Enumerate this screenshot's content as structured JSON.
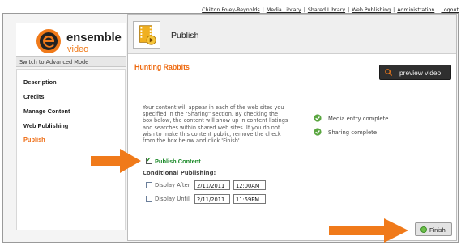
{
  "top_nav": {
    "links": [
      "Chilton Foley-Reynolds",
      "Media Library",
      "Shared Library",
      "Web Publishing",
      "Administration",
      "Logout"
    ],
    "separator": "|"
  },
  "brand": {
    "word1": "ensemble",
    "word2": "video",
    "accent": "#f07a1a"
  },
  "sidebar": {
    "advanced_mode": "Switch to Advanced Mode",
    "items": [
      {
        "label": "Description",
        "active": false
      },
      {
        "label": "Credits",
        "active": false
      },
      {
        "label": "Manage Content",
        "active": false
      },
      {
        "label": "Web Publishing",
        "active": false
      },
      {
        "label": "Publish",
        "active": true
      }
    ]
  },
  "header": {
    "title": "Publish",
    "icon": "film-play-icon"
  },
  "content": {
    "video_title": "Hunting Rabbits",
    "preview_label": "preview video",
    "description": "Your content will appear in each of the web sites you specified in the \"Sharing\" section. By checking the box below, the content will show up in content listings and searches within shared web sites. If you do not wish to make this content public, remove the check from the box below and click 'Finish'.",
    "status": [
      {
        "label": "Media entry complete",
        "icon": "check-circle-icon"
      },
      {
        "label": "Sharing complete",
        "icon": "check-circle-icon"
      }
    ],
    "publish_content": {
      "label": "Publish Content",
      "checked": true
    },
    "conditional": {
      "title": "Conditional Publishing:",
      "after": {
        "label": "Display After",
        "date": "2/11/2011",
        "time": "12:00AM",
        "checked": false
      },
      "until": {
        "label": "Display Until",
        "date": "2/11/2011",
        "time": "11:59PM",
        "checked": false
      }
    },
    "finish_label": "Finish"
  },
  "colors": {
    "accent_orange": "#ee6a10",
    "publish_green": "#1c8a2a",
    "arrow_orange": "#f07a1a"
  }
}
